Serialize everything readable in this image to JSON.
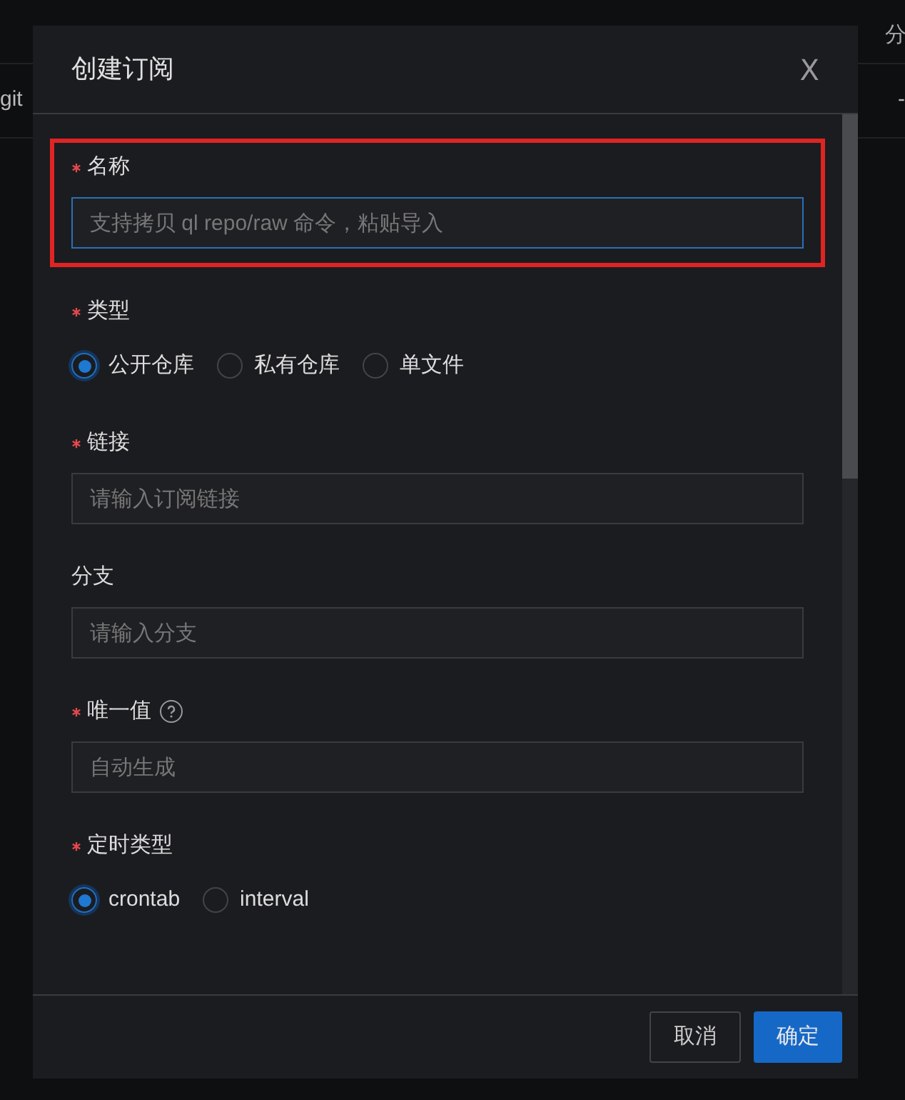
{
  "background_table": {
    "row_cells": [
      "git",
      "-"
    ],
    "header_cells": [
      "分"
    ]
  },
  "dialog": {
    "title": "创建订阅",
    "close": "X",
    "fields": [
      {
        "kind": "input",
        "label": "名称",
        "required": true,
        "highlighted": true,
        "placeholder": "支持拷贝 ql repo/raw 命令，粘贴导入"
      },
      {
        "kind": "radio",
        "label": "类型",
        "required": true,
        "options": [
          {
            "label": "公开仓库",
            "selected": true
          },
          {
            "label": "私有仓库",
            "selected": false
          },
          {
            "label": "单文件",
            "selected": false
          }
        ]
      },
      {
        "kind": "input",
        "label": "链接",
        "required": true,
        "placeholder": "请输入订阅链接"
      },
      {
        "kind": "input",
        "label": "分支",
        "required": false,
        "placeholder": "请输入分支"
      },
      {
        "kind": "input",
        "label": "唯一值",
        "required": true,
        "help": true,
        "placeholder": "自动生成"
      },
      {
        "kind": "radio",
        "label": "定时类型",
        "required": true,
        "options": [
          {
            "label": "crontab",
            "selected": true
          },
          {
            "label": "interval",
            "selected": false
          }
        ]
      }
    ],
    "buttons": [
      {
        "label": "取消",
        "primary": false
      },
      {
        "label": "确定",
        "primary": true
      }
    ]
  }
}
